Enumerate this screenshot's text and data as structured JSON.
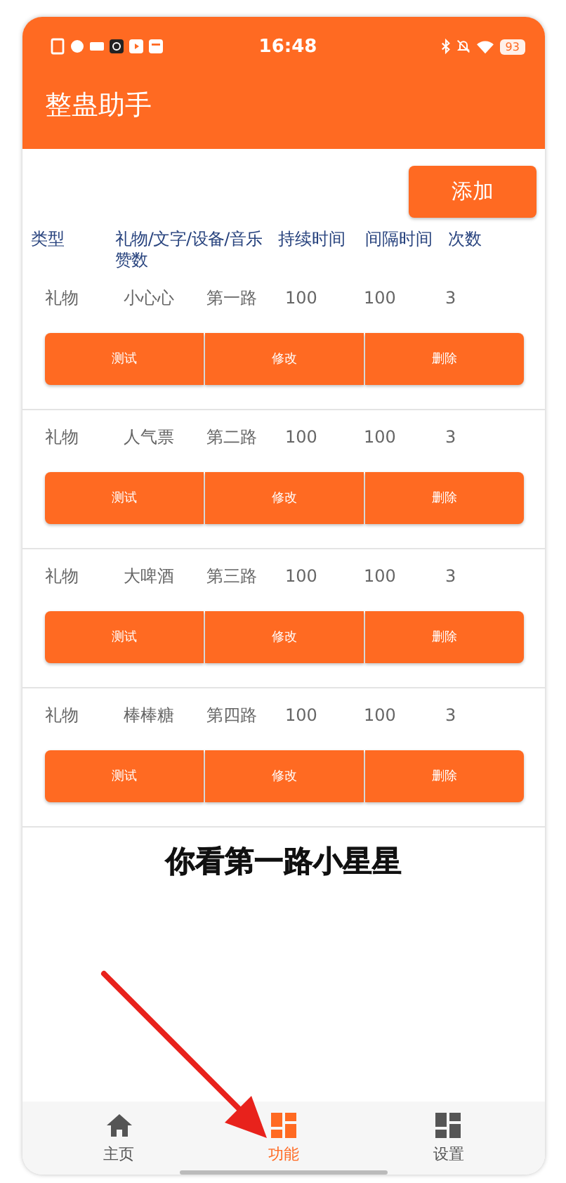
{
  "status_bar": {
    "time": "16:48",
    "battery": "93"
  },
  "app_bar": {
    "title": "整蛊助手"
  },
  "add_button": {
    "label": "添加"
  },
  "table": {
    "columns": [
      "类型",
      "礼物/文字/设备/音乐赞数",
      "持续时间",
      "间隔时间",
      "次数"
    ],
    "rows": [
      {
        "values": [
          "礼物",
          "小心心",
          "第一路",
          "100",
          "100",
          "3"
        ],
        "actions": [
          "测试",
          "修改",
          "删除"
        ]
      },
      {
        "values": [
          "礼物",
          "人气票",
          "第二路",
          "100",
          "100",
          "3"
        ],
        "actions": [
          "测试",
          "修改",
          "删除"
        ]
      },
      {
        "values": [
          "礼物",
          "大啤酒",
          "第三路",
          "100",
          "100",
          "3"
        ],
        "actions": [
          "测试",
          "修改",
          "删除"
        ]
      },
      {
        "values": [
          "礼物",
          "棒棒糖",
          "第四路",
          "100",
          "100",
          "3"
        ],
        "actions": [
          "测试",
          "修改",
          "删除"
        ]
      }
    ]
  },
  "caption": "你看第一路小星星",
  "bottom_nav": [
    {
      "label": "主页",
      "kind": "home",
      "selected": false
    },
    {
      "label": "功能",
      "kind": "grid",
      "selected": true
    },
    {
      "label": "设置",
      "kind": "dashboard",
      "selected": false
    }
  ]
}
